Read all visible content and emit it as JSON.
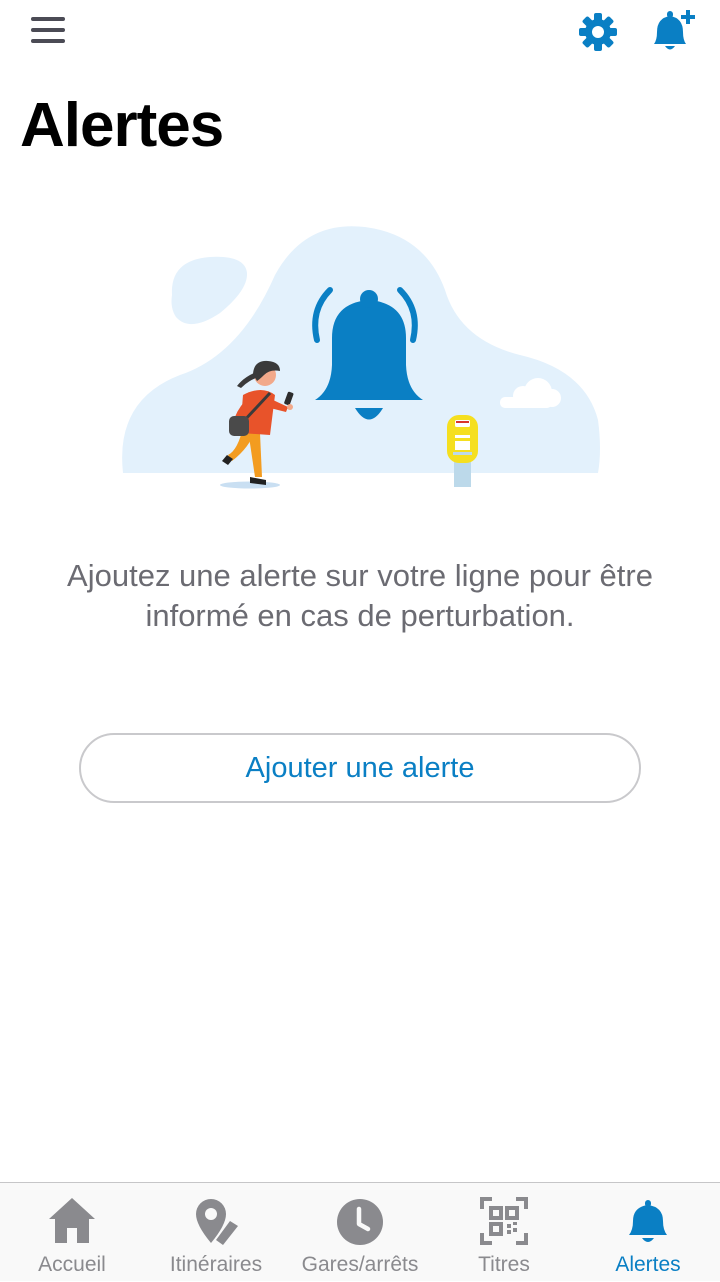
{
  "header": {
    "title": "Alertes",
    "menu_icon": "hamburger-menu-icon",
    "settings_icon": "gear-icon",
    "add_alert_icon": "bell-plus-icon"
  },
  "empty_state": {
    "message": "Ajoutez une alerte sur votre ligne pour être informé en cas de perturbation.",
    "button_label": "Ajouter une alerte"
  },
  "tabbar": {
    "active_tab": "Alertes",
    "tabs": [
      {
        "label": "Accueil",
        "icon": "home-icon"
      },
      {
        "label": "Itinéraires",
        "icon": "map-pin-icon"
      },
      {
        "label": "Gares/arrêts",
        "icon": "clock-icon"
      },
      {
        "label": "Titres",
        "icon": "qr-code-icon"
      },
      {
        "label": "Alertes",
        "icon": "bell-icon"
      }
    ]
  },
  "colors": {
    "accent": "#0a7fc4",
    "text_muted": "#6b6b72",
    "tab_inactive": "#8a8a8e",
    "illustration_blob": "#e3f1fc"
  }
}
